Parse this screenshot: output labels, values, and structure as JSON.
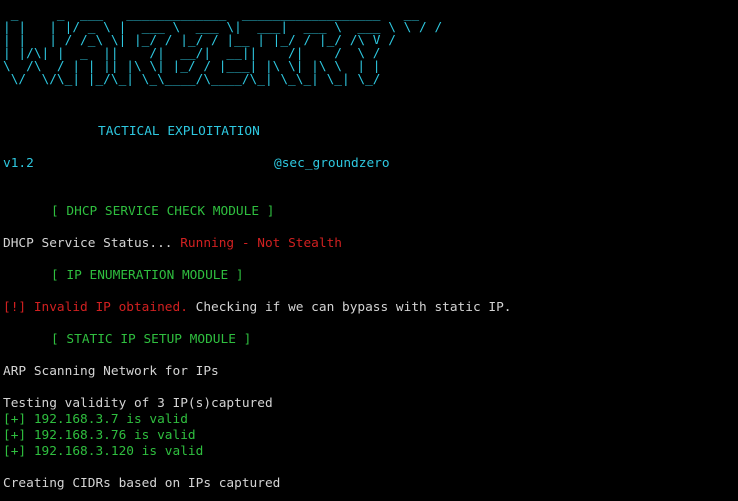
{
  "banner": {
    "ascii_art": " _     _  ___   _____________  __________________   __\n| |   | |/ _ \\ |  ___ \\  ___ \\|  ___|  ___ \\  ___ \\ \\ / /\n| |   | / /_\\ \\| |_/ / |_/ / |__ | |_/ / |_/ /\\ V /\n| |/\\| |  _  ||    /|  __/|  __||    /|    /  \\ /\n\\  /\\  / | | || |\\ \\| |_/ / |___| |\\ \\| |\\ \\  | |\n \\/  \\/\\_| |_/\\_| \\_\\____/\\____/\\_| \\_\\_| \\_| \\_/",
    "subtitle": "TACTICAL EXPLOITATION",
    "version": "v1.2",
    "handle": "@sec_groundzero"
  },
  "modules": {
    "dhcp_header": "[ DHCP SERVICE CHECK MODULE ]",
    "dhcp_status_label": "DHCP Service Status... ",
    "dhcp_status_value": "Running - Not Stealth",
    "ip_enum_header": "[ IP ENUMERATION MODULE ]",
    "invalid_ip_prefix": "[!] Invalid IP obtained.",
    "invalid_ip_rest": " Checking if we can bypass with static IP.",
    "static_ip_header": "[ STATIC IP SETUP MODULE ]",
    "arp_scan": "ARP Scanning Network for IPs",
    "testing_validity": "Testing validity of 3 IP(s)captured",
    "valid_ips": [
      "[+] 192.168.3.7 is valid",
      "[+] 192.168.3.76 is valid",
      "[+] 192.168.3.120 is valid"
    ],
    "creating_cidrs": "Creating CIDRs based on IPs captured"
  },
  "colors": {
    "background": "#000000",
    "cyan": "#2ec8e0",
    "green": "#2fbf3f",
    "red": "#d12020",
    "default_text": "#d4d4d4"
  }
}
